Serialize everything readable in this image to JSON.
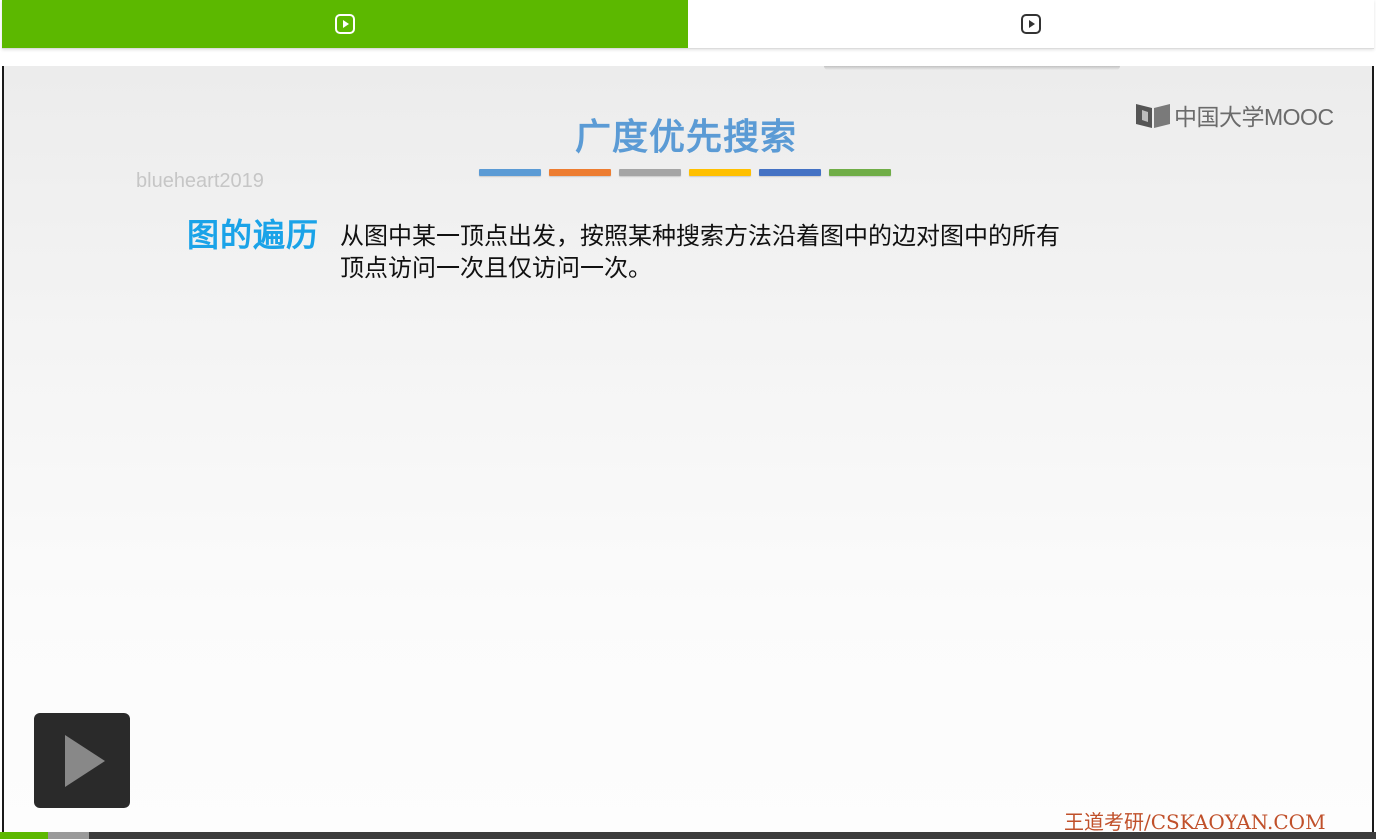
{
  "tabs": [
    {
      "icon": "play-square-icon",
      "active": true
    },
    {
      "icon": "play-square-icon",
      "active": false
    }
  ],
  "slide": {
    "title": "广度优先搜索",
    "title_bar_colors": [
      "#5b9bd5",
      "#ed7d31",
      "#a5a5a5",
      "#ffc000",
      "#4472c4",
      "#70ad47"
    ],
    "logo_text": "中国大学MOOC",
    "watermark": "blueheart2019",
    "section_label": "图的遍历",
    "section_desc": "从图中某一顶点出发，按照某种搜索方法沿着图中的边对图中的所有顶点访问一次且仅访问一次。",
    "footer_brand": "王道考研/CSKAOYAN.COM"
  },
  "player": {
    "play_icon": "play-icon",
    "progress_fraction": 0.035,
    "buffered_fraction": 0.065
  },
  "colors": {
    "accent": "#5cb800",
    "title": "#5b9bd5",
    "section_label": "#1aa3e8",
    "footer": "#c0502a"
  }
}
